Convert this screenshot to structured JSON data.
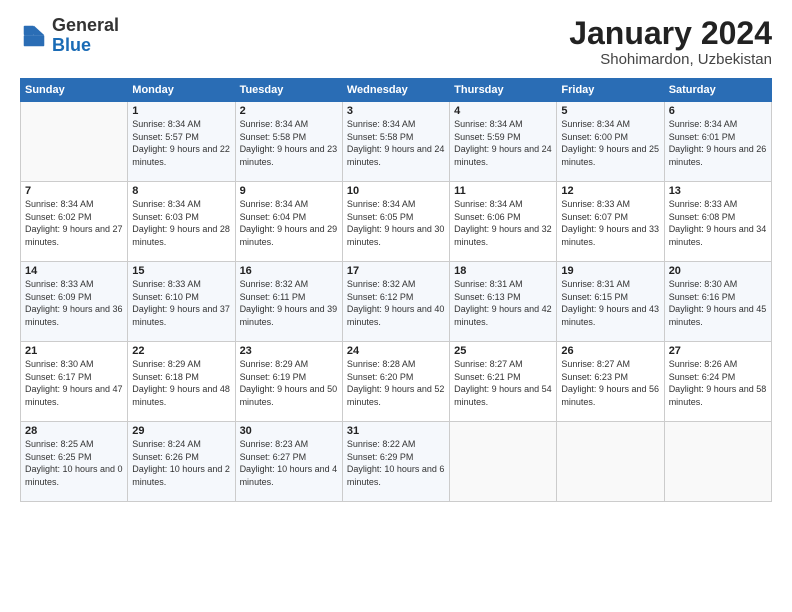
{
  "header": {
    "logo_general": "General",
    "logo_blue": "Blue",
    "month_title": "January 2024",
    "location": "Shohimardon, Uzbekistan"
  },
  "weekdays": [
    "Sunday",
    "Monday",
    "Tuesday",
    "Wednesday",
    "Thursday",
    "Friday",
    "Saturday"
  ],
  "weeks": [
    [
      {
        "day": "",
        "sunrise": "",
        "sunset": "",
        "daylight": ""
      },
      {
        "day": "1",
        "sunrise": "Sunrise: 8:34 AM",
        "sunset": "Sunset: 5:57 PM",
        "daylight": "Daylight: 9 hours and 22 minutes."
      },
      {
        "day": "2",
        "sunrise": "Sunrise: 8:34 AM",
        "sunset": "Sunset: 5:58 PM",
        "daylight": "Daylight: 9 hours and 23 minutes."
      },
      {
        "day": "3",
        "sunrise": "Sunrise: 8:34 AM",
        "sunset": "Sunset: 5:58 PM",
        "daylight": "Daylight: 9 hours and 24 minutes."
      },
      {
        "day": "4",
        "sunrise": "Sunrise: 8:34 AM",
        "sunset": "Sunset: 5:59 PM",
        "daylight": "Daylight: 9 hours and 24 minutes."
      },
      {
        "day": "5",
        "sunrise": "Sunrise: 8:34 AM",
        "sunset": "Sunset: 6:00 PM",
        "daylight": "Daylight: 9 hours and 25 minutes."
      },
      {
        "day": "6",
        "sunrise": "Sunrise: 8:34 AM",
        "sunset": "Sunset: 6:01 PM",
        "daylight": "Daylight: 9 hours and 26 minutes."
      }
    ],
    [
      {
        "day": "7",
        "sunrise": "Sunrise: 8:34 AM",
        "sunset": "Sunset: 6:02 PM",
        "daylight": "Daylight: 9 hours and 27 minutes."
      },
      {
        "day": "8",
        "sunrise": "Sunrise: 8:34 AM",
        "sunset": "Sunset: 6:03 PM",
        "daylight": "Daylight: 9 hours and 28 minutes."
      },
      {
        "day": "9",
        "sunrise": "Sunrise: 8:34 AM",
        "sunset": "Sunset: 6:04 PM",
        "daylight": "Daylight: 9 hours and 29 minutes."
      },
      {
        "day": "10",
        "sunrise": "Sunrise: 8:34 AM",
        "sunset": "Sunset: 6:05 PM",
        "daylight": "Daylight: 9 hours and 30 minutes."
      },
      {
        "day": "11",
        "sunrise": "Sunrise: 8:34 AM",
        "sunset": "Sunset: 6:06 PM",
        "daylight": "Daylight: 9 hours and 32 minutes."
      },
      {
        "day": "12",
        "sunrise": "Sunrise: 8:33 AM",
        "sunset": "Sunset: 6:07 PM",
        "daylight": "Daylight: 9 hours and 33 minutes."
      },
      {
        "day": "13",
        "sunrise": "Sunrise: 8:33 AM",
        "sunset": "Sunset: 6:08 PM",
        "daylight": "Daylight: 9 hours and 34 minutes."
      }
    ],
    [
      {
        "day": "14",
        "sunrise": "Sunrise: 8:33 AM",
        "sunset": "Sunset: 6:09 PM",
        "daylight": "Daylight: 9 hours and 36 minutes."
      },
      {
        "day": "15",
        "sunrise": "Sunrise: 8:33 AM",
        "sunset": "Sunset: 6:10 PM",
        "daylight": "Daylight: 9 hours and 37 minutes."
      },
      {
        "day": "16",
        "sunrise": "Sunrise: 8:32 AM",
        "sunset": "Sunset: 6:11 PM",
        "daylight": "Daylight: 9 hours and 39 minutes."
      },
      {
        "day": "17",
        "sunrise": "Sunrise: 8:32 AM",
        "sunset": "Sunset: 6:12 PM",
        "daylight": "Daylight: 9 hours and 40 minutes."
      },
      {
        "day": "18",
        "sunrise": "Sunrise: 8:31 AM",
        "sunset": "Sunset: 6:13 PM",
        "daylight": "Daylight: 9 hours and 42 minutes."
      },
      {
        "day": "19",
        "sunrise": "Sunrise: 8:31 AM",
        "sunset": "Sunset: 6:15 PM",
        "daylight": "Daylight: 9 hours and 43 minutes."
      },
      {
        "day": "20",
        "sunrise": "Sunrise: 8:30 AM",
        "sunset": "Sunset: 6:16 PM",
        "daylight": "Daylight: 9 hours and 45 minutes."
      }
    ],
    [
      {
        "day": "21",
        "sunrise": "Sunrise: 8:30 AM",
        "sunset": "Sunset: 6:17 PM",
        "daylight": "Daylight: 9 hours and 47 minutes."
      },
      {
        "day": "22",
        "sunrise": "Sunrise: 8:29 AM",
        "sunset": "Sunset: 6:18 PM",
        "daylight": "Daylight: 9 hours and 48 minutes."
      },
      {
        "day": "23",
        "sunrise": "Sunrise: 8:29 AM",
        "sunset": "Sunset: 6:19 PM",
        "daylight": "Daylight: 9 hours and 50 minutes."
      },
      {
        "day": "24",
        "sunrise": "Sunrise: 8:28 AM",
        "sunset": "Sunset: 6:20 PM",
        "daylight": "Daylight: 9 hours and 52 minutes."
      },
      {
        "day": "25",
        "sunrise": "Sunrise: 8:27 AM",
        "sunset": "Sunset: 6:21 PM",
        "daylight": "Daylight: 9 hours and 54 minutes."
      },
      {
        "day": "26",
        "sunrise": "Sunrise: 8:27 AM",
        "sunset": "Sunset: 6:23 PM",
        "daylight": "Daylight: 9 hours and 56 minutes."
      },
      {
        "day": "27",
        "sunrise": "Sunrise: 8:26 AM",
        "sunset": "Sunset: 6:24 PM",
        "daylight": "Daylight: 9 hours and 58 minutes."
      }
    ],
    [
      {
        "day": "28",
        "sunrise": "Sunrise: 8:25 AM",
        "sunset": "Sunset: 6:25 PM",
        "daylight": "Daylight: 10 hours and 0 minutes."
      },
      {
        "day": "29",
        "sunrise": "Sunrise: 8:24 AM",
        "sunset": "Sunset: 6:26 PM",
        "daylight": "Daylight: 10 hours and 2 minutes."
      },
      {
        "day": "30",
        "sunrise": "Sunrise: 8:23 AM",
        "sunset": "Sunset: 6:27 PM",
        "daylight": "Daylight: 10 hours and 4 minutes."
      },
      {
        "day": "31",
        "sunrise": "Sunrise: 8:22 AM",
        "sunset": "Sunset: 6:29 PM",
        "daylight": "Daylight: 10 hours and 6 minutes."
      },
      {
        "day": "",
        "sunrise": "",
        "sunset": "",
        "daylight": ""
      },
      {
        "day": "",
        "sunrise": "",
        "sunset": "",
        "daylight": ""
      },
      {
        "day": "",
        "sunrise": "",
        "sunset": "",
        "daylight": ""
      }
    ]
  ]
}
